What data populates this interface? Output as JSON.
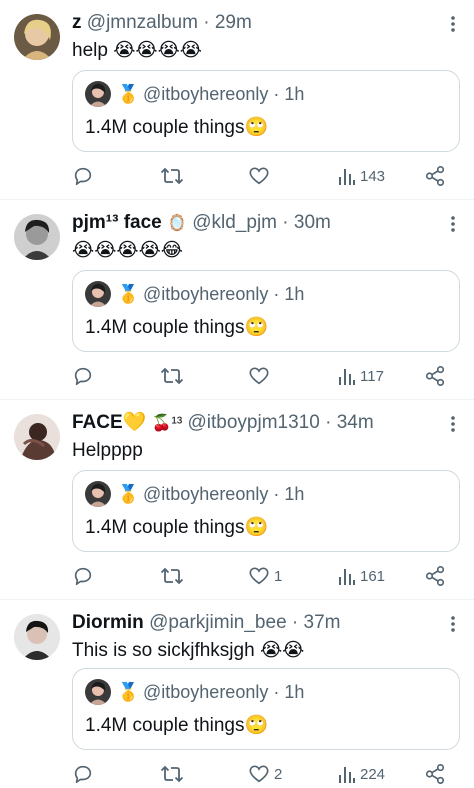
{
  "tweets": [
    {
      "name": "z",
      "badge": "",
      "handle": "@jmnzalbum",
      "sep": " · ",
      "time": "29m",
      "text": "help 😭😭😭😭",
      "quote": {
        "medal": "🥇",
        "handle": "@itboyhereonly",
        "sep": " · ",
        "time": "1h",
        "text": "1.4M couple things🙄"
      },
      "likes": "",
      "views": "143"
    },
    {
      "name": "pjm¹³ face",
      "badge": "🪞",
      "handle": "@kld_pjm",
      "sep": " · ",
      "time": "30m",
      "text": "😭😭😭😭😂",
      "quote": {
        "medal": "🥇",
        "handle": "@itboyhereonly",
        "sep": " · ",
        "time": "1h",
        "text": "1.4M couple things🙄"
      },
      "likes": "",
      "views": "117"
    },
    {
      "name": "FACE💛",
      "badge": "🍒¹³",
      "handle": "@itboypjm1310",
      "sep": " · ",
      "time": "34m",
      "text": "Helpppp",
      "quote": {
        "medal": "🥇",
        "handle": "@itboyhereonly",
        "sep": " · ",
        "time": "1h",
        "text": "1.4M couple things🙄"
      },
      "likes": "1",
      "views": "161"
    },
    {
      "name": "Diormin",
      "badge": "",
      "handle": "@parkjimin_bee",
      "sep": " · ",
      "time": "37m",
      "text": "This is so sickjfhksjgh 😭😭",
      "quote": {
        "medal": "🥇",
        "handle": "@itboyhereonly",
        "sep": " · ",
        "time": "1h",
        "text": "1.4M couple things🙄"
      },
      "likes": "2",
      "views": "224"
    }
  ],
  "icons": {
    "reply": "reply-icon",
    "retweet": "retweet-icon",
    "like": "heart-icon",
    "views": "views-icon",
    "share": "share-icon",
    "more": "more-vertical-icon"
  },
  "colors": {
    "icon_gray": "#536471",
    "border": "#cfd9de",
    "divider": "#eff3f4"
  }
}
